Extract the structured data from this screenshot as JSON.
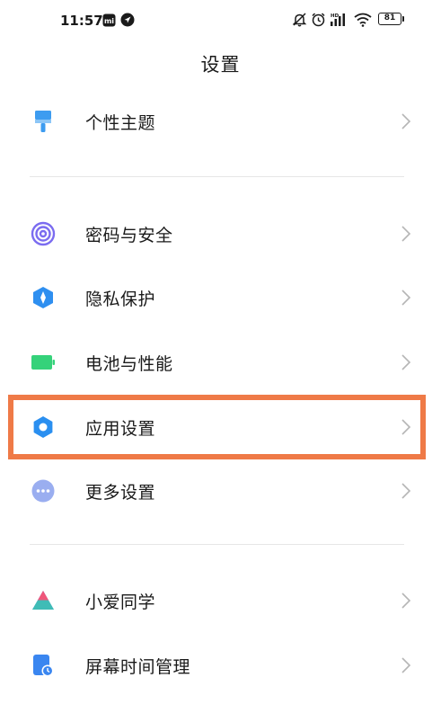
{
  "status_bar": {
    "time": "11:57",
    "battery": "81",
    "left_icons": [
      "mi-store-icon",
      "navigation-icon"
    ],
    "right_icons": [
      "mute-icon",
      "alarm-icon",
      "hd-signal-icon",
      "wifi-icon",
      "battery-icon"
    ]
  },
  "header": {
    "title": "设置"
  },
  "groups": [
    {
      "items": [
        {
          "label": "个性主题",
          "icon": "theme-brush-icon",
          "color": "#3d9cf0"
        }
      ]
    },
    {
      "items": [
        {
          "label": "密码与安全",
          "icon": "fingerprint-icon",
          "color": "#7b6cf0"
        },
        {
          "label": "隐私保护",
          "icon": "privacy-shield-icon",
          "color": "#2e8ff0"
        },
        {
          "label": "电池与性能",
          "icon": "battery-performance-icon",
          "color": "#35d27a"
        },
        {
          "label": "应用设置",
          "icon": "gear-icon",
          "color": "#2a8ff0"
        },
        {
          "label": "更多设置",
          "icon": "more-dots-icon",
          "color": "#9aaef0"
        }
      ]
    },
    {
      "items": [
        {
          "label": "小爱同学",
          "icon": "xiaoai-icon",
          "color": "#5b7cf5"
        },
        {
          "label": "屏幕时间管理",
          "icon": "screen-time-icon",
          "color": "#3a86f0"
        }
      ]
    }
  ],
  "highlight": {
    "target": "应用设置",
    "color": "#ef7a47"
  }
}
